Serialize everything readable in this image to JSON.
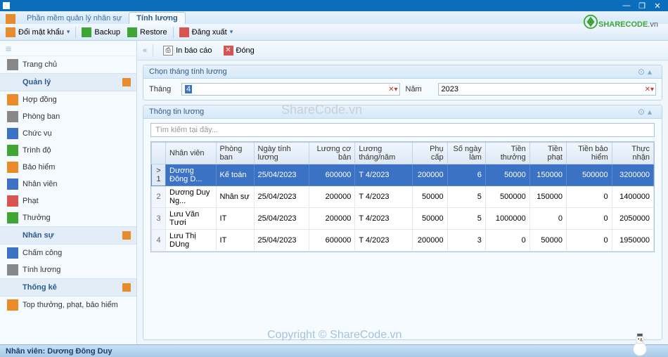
{
  "titlebar": {
    "blank": " "
  },
  "ribbon": {
    "app_tab": "Phần mềm quản lý nhân sự",
    "active_tab": "Tính lương"
  },
  "toolbar": {
    "change_pw": "Đổi mật khẩu",
    "backup": "Backup",
    "restore": "Restore",
    "logout": "Đăng xuất"
  },
  "sidebar": {
    "items": [
      {
        "label": "Trang chủ",
        "group": false
      },
      {
        "label": "Quản lý",
        "group": true
      },
      {
        "label": "Hợp đồng",
        "group": false
      },
      {
        "label": "Phòng ban",
        "group": false
      },
      {
        "label": "Chức vụ",
        "group": false
      },
      {
        "label": "Trình độ",
        "group": false
      },
      {
        "label": "Bảo hiểm",
        "group": false
      },
      {
        "label": "Nhân viên",
        "group": false
      },
      {
        "label": "Phạt",
        "group": false
      },
      {
        "label": "Thưởng",
        "group": false
      },
      {
        "label": "Nhân sự",
        "group": true
      },
      {
        "label": "Chấm công",
        "group": false
      },
      {
        "label": "Tính lương",
        "group": false
      },
      {
        "label": "Thống kê",
        "group": true
      },
      {
        "label": "Top thưởng, phạt, bảo hiểm",
        "group": false
      }
    ]
  },
  "content_toolbar": {
    "print": "In báo cáo",
    "close": "Đóng"
  },
  "panel_month": {
    "title": "Chọn tháng tính lương",
    "month_label": "Tháng",
    "month_value": "4",
    "year_label": "Năm",
    "year_value": "2023"
  },
  "panel_info": {
    "title": "Thông tin lương",
    "search_placeholder": "Tìm kiếm tại đây..."
  },
  "grid": {
    "columns": [
      "",
      "Nhân viên",
      "Phòng ban",
      "Ngày tính lương",
      "Lương cơ bản",
      "Lương tháng/năm",
      "Phụ cấp",
      "Số ngày làm",
      "Tiền thưởng",
      "Tiền phạt",
      "Tiền bảo hiểm",
      "Thực nhận"
    ],
    "rows": [
      {
        "n": "1",
        "nv": "Dương Đông D...",
        "pb": "Kế toán",
        "ngay": "25/04/2023",
        "lcb": "600000",
        "ltn": "T 4/2023",
        "pc": "200000",
        "snl": "6",
        "tt": "50000",
        "tp": "150000",
        "tbh": "500000",
        "tn": "3200000",
        "selected": true
      },
      {
        "n": "2",
        "nv": "Dương Duy Ng...",
        "pb": "Nhân sự",
        "ngay": "25/04/2023",
        "lcb": "200000",
        "ltn": "T 4/2023",
        "pc": "50000",
        "snl": "5",
        "tt": "500000",
        "tp": "150000",
        "tbh": "0",
        "tn": "1400000"
      },
      {
        "n": "3",
        "nv": "Lưu Văn Tươi",
        "pb": "IT",
        "ngay": "25/04/2023",
        "lcb": "200000",
        "ltn": "T 4/2023",
        "pc": "50000",
        "snl": "5",
        "tt": "1000000",
        "tp": "0",
        "tbh": "0",
        "tn": "2050000"
      },
      {
        "n": "4",
        "nv": "Lưu Thị DUng",
        "pb": "IT",
        "ngay": "25/04/2023",
        "lcb": "600000",
        "ltn": "T 4/2023",
        "pc": "200000",
        "snl": "3",
        "tt": "0",
        "tp": "50000",
        "tbh": "0",
        "tn": "1950000"
      }
    ]
  },
  "statusbar": {
    "text": "Nhân viên: Dương Đông Duy"
  },
  "brand": {
    "text1": "SHARE",
    "text2": "CODE",
    "text3": ".vn"
  },
  "watermark1": "ShareCode.vn",
  "watermark2": "Copyright © ShareCode.vn"
}
